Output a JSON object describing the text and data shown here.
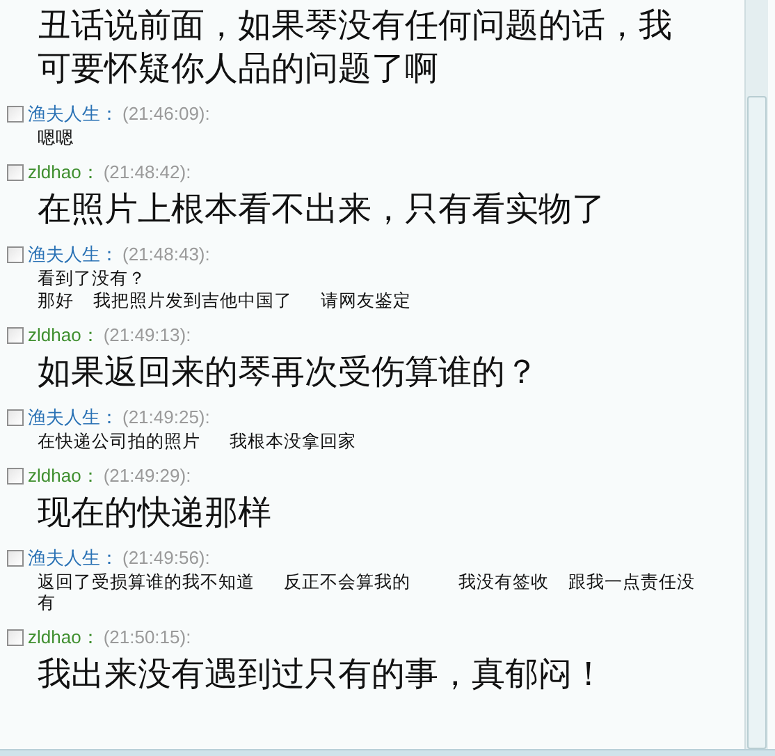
{
  "messages": [
    {
      "kind": "large",
      "lines": [
        "丑话说前面，如果琴没有任何问题的话，我可要怀疑你人品的问题了啊"
      ]
    },
    {
      "sender": "渔夫人生：",
      "color": "#2a72b5",
      "time": "(21:46:09):",
      "checked": false,
      "kind": "small",
      "lines": [
        "嗯嗯"
      ]
    },
    {
      "sender": "zldhao：",
      "color": "#3f8f2f",
      "time": "(21:48:42):",
      "checked": false,
      "kind": "large",
      "lines": [
        "在照片上根本看不出来，只有看实物了"
      ]
    },
    {
      "sender": "渔夫人生：",
      "color": "#2a72b5",
      "time": "(21:48:43):",
      "checked": false,
      "kind": "small",
      "lines": [
        "看到了没有？",
        "那好    我把照片发到吉他中国了      请网友鉴定"
      ]
    },
    {
      "sender": "zldhao：",
      "color": "#3f8f2f",
      "time": "(21:49:13):",
      "checked": false,
      "kind": "large",
      "lines": [
        "如果返回来的琴再次受伤算谁的？"
      ]
    },
    {
      "sender": "渔夫人生：",
      "color": "#2a72b5",
      "time": "(21:49:25):",
      "checked": false,
      "kind": "small",
      "lines": [
        "在快递公司拍的照片      我根本没拿回家"
      ]
    },
    {
      "sender": "zldhao：",
      "color": "#3f8f2f",
      "time": "(21:49:29):",
      "checked": false,
      "kind": "large",
      "lines": [
        "现在的快递那样"
      ]
    },
    {
      "sender": "渔夫人生：",
      "color": "#2a72b5",
      "time": "(21:49:56):",
      "checked": false,
      "kind": "small",
      "lines": [
        "返回了受损算谁的我不知道      反正不会算我的          我没有签收    跟我一点责任没有"
      ]
    },
    {
      "sender": "zldhao：",
      "color": "#3f8f2f",
      "time": "(21:50:15):",
      "checked": false,
      "kind": "large",
      "lines": [
        "我出来没有遇到过只有的事，真郁闷！"
      ]
    }
  ]
}
